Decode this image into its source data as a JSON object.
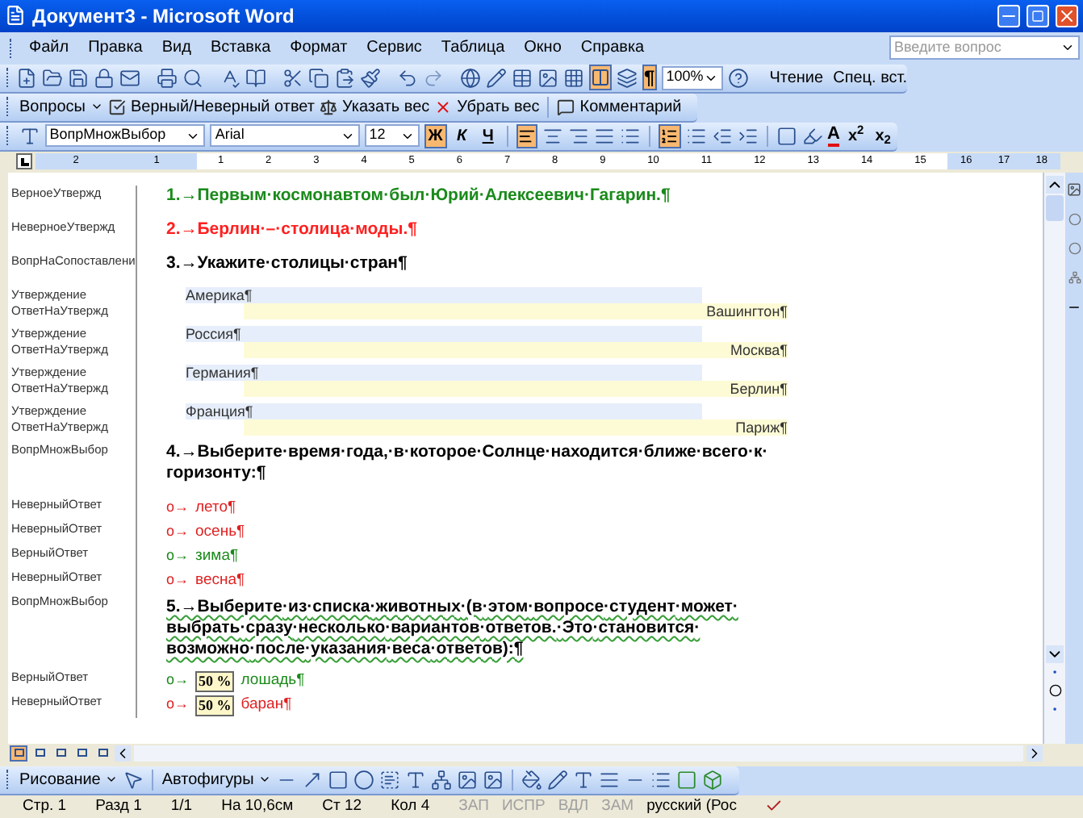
{
  "window": {
    "title": "Документ3 - Microsoft Word"
  },
  "menu": [
    "Файл",
    "Правка",
    "Вид",
    "Вставка",
    "Формат",
    "Сервис",
    "Таблица",
    "Окно",
    "Справка"
  ],
  "help_search": {
    "placeholder": "Введите вопрос"
  },
  "standard_toolbar": {
    "zoom": "100%",
    "reading_selected": true,
    "pilcrow_selected": true,
    "pilcrow": "¶",
    "buttons": [
      "Чтение",
      "Спец. вст."
    ]
  },
  "questions_toolbar": [
    {
      "kind": "menu",
      "label": "Вопросы"
    },
    {
      "kind": "truefalse",
      "label": "Верный/Неверный ответ"
    },
    {
      "kind": "weight",
      "label": "Указать вес"
    },
    {
      "kind": "remove",
      "label": "Убрать вес"
    },
    {
      "kind": "comment",
      "label": "Комментарий"
    }
  ],
  "formatting_toolbar": {
    "style": "ВопрМножВыбор",
    "font": "Arial",
    "size": "12",
    "buttons": [
      {
        "label": "Ж",
        "selected": true
      },
      {
        "label": "К",
        "selected": false
      },
      {
        "label": "Ч",
        "selected": false
      }
    ],
    "align_left_selected": true,
    "numbering_selected": true,
    "script_buttons": [
      "x$^{2}$",
      "x$_{2}$"
    ],
    "font_color_label": "A"
  },
  "ruler": [
    "2",
    "1",
    "1",
    "2",
    "3",
    "4",
    "5",
    "6",
    "7",
    "8",
    "9",
    "10",
    "11",
    "12",
    "13",
    "14",
    "15",
    "16",
    "17",
    "18"
  ],
  "document": [
    {
      "kind": "question",
      "style": "ВерноеУтвержд",
      "text": "1.→Первым·космонавтом·был·Юрий·Алексеевич·Гагарин.¶",
      "color": "#1a8a1a",
      "grammar_flag": false
    },
    {
      "kind": "question",
      "style": "НеверноеУтвержд",
      "text": "2.→Берлин·–·столица·моды.¶",
      "color": "#ff2020",
      "grammar_flag": false
    },
    {
      "kind": "question",
      "style": "ВопрНаСопоставлени",
      "text": "3.→Укажите·столицы·стран¶",
      "color": "#000000",
      "grammar_flag": false
    },
    {
      "kind": "match",
      "style": "Утверждение",
      "answer_style": "ОтветНаУтвержд",
      "left": "Америка¶",
      "right": "Вашингтон¶"
    },
    {
      "kind": "match",
      "style": "Утверждение",
      "answer_style": "ОтветНаУтвержд",
      "left": "Россия¶",
      "right": "Москва¶"
    },
    {
      "kind": "match",
      "style": "Утверждение",
      "answer_style": "ОтветНаУтвержд",
      "left": "Германия¶",
      "right": "Берлин¶"
    },
    {
      "kind": "match",
      "style": "Утверждение",
      "answer_style": "ОтветНаУтвержд",
      "left": "Франция¶",
      "right": "Париж¶"
    },
    {
      "kind": "question",
      "style": "ВопрМножВыбор",
      "text": "4.→Выберите·время·года,·в·которое·Солнце·находится·ближе·всего·к·горизонту:¶",
      "color": "#000000",
      "grammar_flag": false
    },
    {
      "kind": "option",
      "style": "НеверныйОтвет",
      "bullet": "o→",
      "text": "лето¶",
      "correct": false
    },
    {
      "kind": "option",
      "style": "НеверныйОтвет",
      "bullet": "o→",
      "text": "осень¶",
      "correct": false
    },
    {
      "kind": "option",
      "style": "ВерныйОтвет",
      "bullet": "o→",
      "text": "зима¶",
      "correct": true
    },
    {
      "kind": "option",
      "style": "НеверныйОтвет",
      "bullet": "o→",
      "text": "весна¶",
      "correct": false
    },
    {
      "kind": "question",
      "style": "ВопрМножВыбор",
      "text": "5.→Выберите·из·списка·животных·(в·этом·вопросе·студент·может·выбрать·сразу·несколько·вариантов·ответов.·Это·становится·возможно·после·указания·веса·ответов):¶",
      "color": "#000000",
      "grammar_flag": true
    },
    {
      "kind": "weighted_option",
      "style": "ВерныйОтвет",
      "bullet": "o→",
      "weight": "50 %",
      "text": "лошадь¶",
      "correct": true
    },
    {
      "kind": "weighted_option",
      "style": "НеверныйОтвет",
      "bullet": "o→",
      "weight": "50 %",
      "text": "баран¶",
      "correct": false
    }
  ],
  "view_modes": [
    {
      "selected": true
    },
    {
      "selected": false
    },
    {
      "selected": false
    },
    {
      "selected": false
    },
    {
      "selected": false
    }
  ],
  "drawing_toolbar": [
    "Рисование",
    "Автофигуры"
  ],
  "status_bar": [
    {
      "text": "Стр. 1",
      "disabled": false
    },
    {
      "text": "Разд 1",
      "disabled": false
    },
    {
      "text": "1/1",
      "disabled": false
    },
    {
      "text": "На 10,6см",
      "disabled": false
    },
    {
      "text": "Ст 12",
      "disabled": false
    },
    {
      "text": "Кол 4",
      "disabled": false
    },
    {
      "text": "ЗАП",
      "disabled": true
    },
    {
      "text": "ИСПР",
      "disabled": true
    },
    {
      "text": "ВДЛ",
      "disabled": true
    },
    {
      "text": "ЗАМ",
      "disabled": true
    },
    {
      "text": "русский (Рос",
      "disabled": false
    }
  ]
}
